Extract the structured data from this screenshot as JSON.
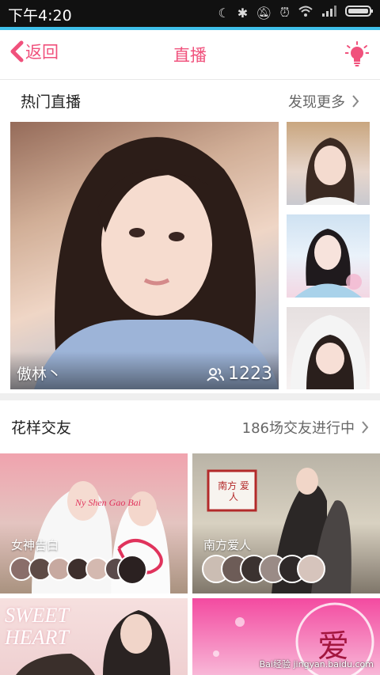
{
  "status_bar": {
    "time": "下午4:20",
    "icons": [
      "moon-icon",
      "bluetooth-icon",
      "mute-icon",
      "alarm-icon",
      "wifi-icon",
      "signal-icon",
      "battery-icon"
    ]
  },
  "nav": {
    "back_label": "返回",
    "title": "直播",
    "accent": "#f0517c"
  },
  "hot_live": {
    "title": "热门直播",
    "more": "发现更多",
    "featured": {
      "name": "傲林丶",
      "viewers": "1223"
    }
  },
  "friend_section": {
    "title": "花样交友",
    "count_text": "186场交友进行中",
    "rooms": [
      {
        "name": "女神告白",
        "poster_text": "Ny Shen Gao Bai"
      },
      {
        "name": "南方爱人",
        "poster_text": "南方 爱人"
      },
      {
        "name": "",
        "poster_text": "SWEET HEART"
      },
      {
        "name": "",
        "poster_text": "爱"
      }
    ]
  },
  "watermark": "Bai经验 jingyan.baidu.com"
}
